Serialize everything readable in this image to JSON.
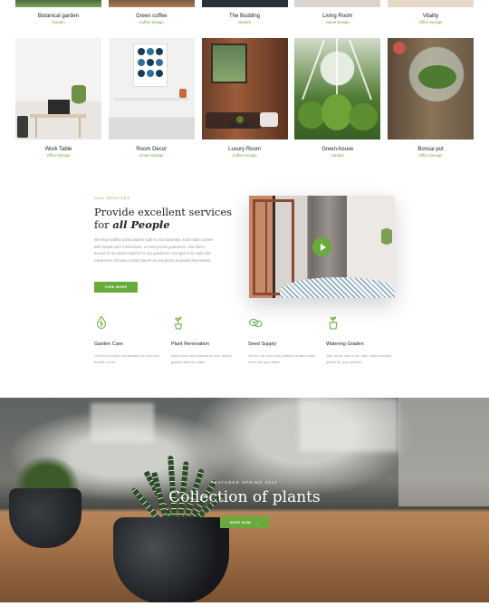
{
  "portfolio": {
    "top_row": [
      {
        "title": "Botanical garden",
        "category": "Garden"
      },
      {
        "title": "Green coffee",
        "category": "Coffee Design"
      },
      {
        "title": "The Budding",
        "category": "Garden"
      },
      {
        "title": "Living Room",
        "category": "Home Design"
      },
      {
        "title": "Vitality",
        "category": "Office Design"
      }
    ],
    "bottom_row": [
      {
        "title": "Work Table",
        "category": "Office Design"
      },
      {
        "title": "Room Decor",
        "category": "Home Design"
      },
      {
        "title": "Luxury Room",
        "category": "Coffee Design"
      },
      {
        "title": "Green-house",
        "category": "Garden"
      },
      {
        "title": "Bonsai pot",
        "category": "Office Design"
      }
    ]
  },
  "about": {
    "eyebrow": "Our Services",
    "heading_line1": "Provide excellent services",
    "heading_line2_prefix": "for ",
    "heading_line2_emphasis": "all People",
    "body": "We ship healthy potted plants right to your doorstep. Each plant comes with simple care instructions, a money-back guarantee, and direct access to our plant experts for any questions. Our goal is to make the experience of being a plant parent as wonderful as plants themselves.",
    "button_label": "VIEW MORE"
  },
  "services": [
    {
      "icon": "drop-icon",
      "title": "Garden Care",
      "desc": "Let's find a plant combination to suit your border or pot"
    },
    {
      "icon": "plant-icon",
      "title": "Plant Renovation",
      "desc": "Add colour and interest to your spring garden with our plant"
    },
    {
      "icon": "seed-icon",
      "title": "Seed Supply",
      "desc": "We do not have only plants but also many seed suit your state."
    },
    {
      "icon": "watering-icon",
      "title": "Watering Graden",
      "desc": "Join us for one of our open days and find plants for your garden."
    }
  ],
  "hero": {
    "kicker": "FEATURED SPRING 2017",
    "title": "Collection of plants",
    "button_label": "SHOP NOW",
    "button_arrow": "→"
  },
  "colors": {
    "accent": "#6aa93b",
    "text_dark": "#222222",
    "text_muted": "#9a9a9a"
  }
}
